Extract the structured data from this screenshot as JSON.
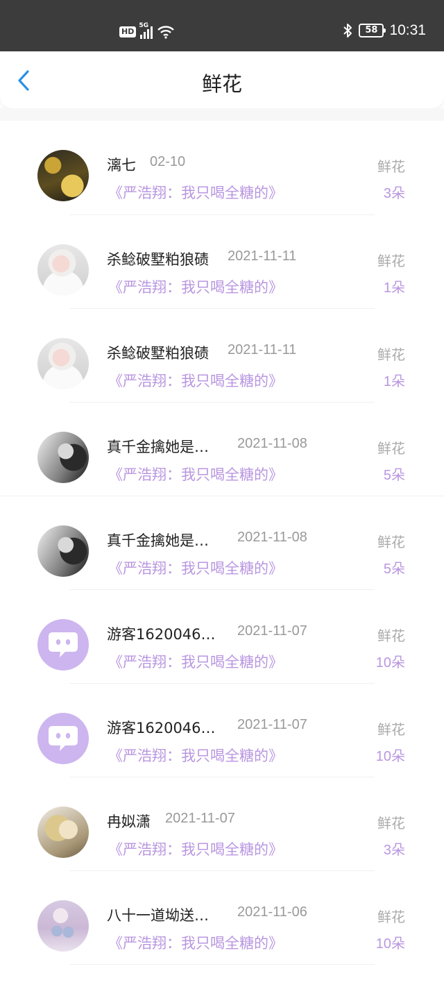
{
  "status_bar": {
    "hd": "HD",
    "network": "5G",
    "battery": "58",
    "time": "10:31"
  },
  "nav": {
    "title": "鲜花"
  },
  "rows": [
    {
      "name": "漓七",
      "date": "02-10",
      "book": "《严浩翔：我只喝全糖的》",
      "label": "鲜花",
      "count": "3朵"
    },
    {
      "name": "杀鲶破墅粕狼碛",
      "date": "2021-11-11",
      "book": "《严浩翔：我只喝全糖的》",
      "label": "鲜花",
      "count": "1朵"
    },
    {
      "name": "杀鲶破墅粕狼碛",
      "date": "2021-11-11",
      "book": "《严浩翔：我只喝全糖的》",
      "label": "鲜花",
      "count": "1朵"
    },
    {
      "name": "真千金擒她是…",
      "date": "2021-11-08",
      "book": "《严浩翔：我只喝全糖的》",
      "label": "鲜花",
      "count": "5朵"
    },
    {
      "name": "真千金擒她是…",
      "date": "2021-11-08",
      "book": "《严浩翔：我只喝全糖的》",
      "label": "鲜花",
      "count": "5朵"
    },
    {
      "name": "游客1620046…",
      "date": "2021-11-07",
      "book": "《严浩翔：我只喝全糖的》",
      "label": "鲜花",
      "count": "10朵"
    },
    {
      "name": "游客1620046…",
      "date": "2021-11-07",
      "book": "《严浩翔：我只喝全糖的》",
      "label": "鲜花",
      "count": "10朵"
    },
    {
      "name": "冉姒潇",
      "date": "2021-11-07",
      "book": "《严浩翔：我只喝全糖的》",
      "label": "鲜花",
      "count": "3朵"
    },
    {
      "name": "八十一道坳送…",
      "date": "2021-11-06",
      "book": "《严浩翔：我只喝全糖的》",
      "label": "鲜花",
      "count": "10朵"
    }
  ],
  "colors": {
    "accent": "#b996e0",
    "back_arrow": "#2b8fe6",
    "status_bar": "#3c3c3c"
  }
}
